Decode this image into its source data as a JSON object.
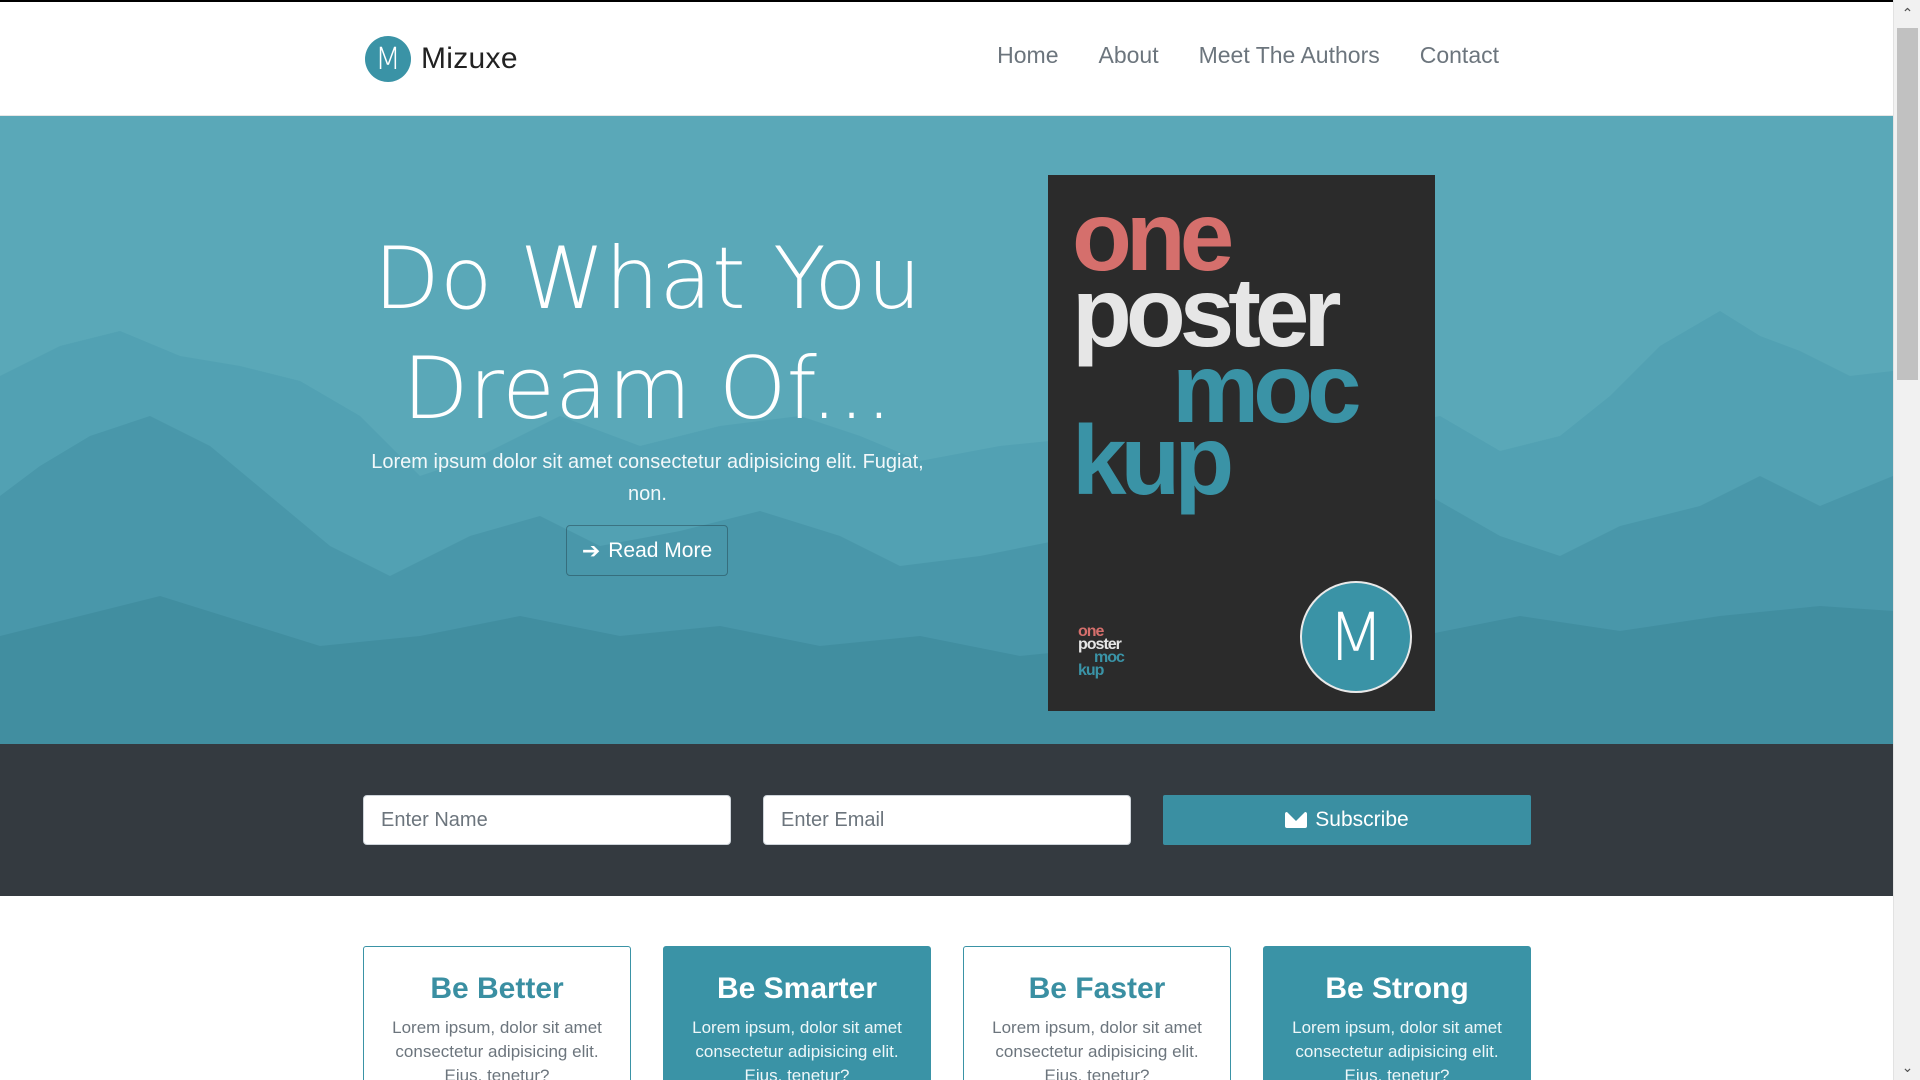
{
  "brand": {
    "logo_letter": "M",
    "name": "Mizuxe"
  },
  "nav": {
    "items": [
      {
        "label": "Home"
      },
      {
        "label": "About"
      },
      {
        "label": "Meet The Authors"
      },
      {
        "label": "Contact"
      }
    ]
  },
  "hero": {
    "title_line1": "Do What You",
    "title_line2": "Dream Of...",
    "text": "Lorem ipsum dolor sit amet consectetur adipisicing elit. Fugiat, non.",
    "button_label": "Read More",
    "button_icon": "arrow-right-icon",
    "background_color": "#5aa8b8"
  },
  "poster": {
    "word1": "one",
    "word2": "poster",
    "word3": "moc",
    "word4": "kup",
    "badge_letter": "M",
    "colors": {
      "one": "#d56f6c",
      "poster": "#e6e6e6",
      "mockup": "#3a93a6",
      "background": "#2b2b2b"
    }
  },
  "subscribe": {
    "name_placeholder": "Enter Name",
    "email_placeholder": "Enter Email",
    "button_label": "Subscribe",
    "button_icon": "envelope-icon",
    "background_color": "#343a40",
    "accent_color": "#3a8fa2"
  },
  "features": [
    {
      "title": "Be Better",
      "text": "Lorem ipsum, dolor sit amet consectetur adipisicing elit. Eius, tenetur?",
      "style": "light"
    },
    {
      "title": "Be Smarter",
      "text": "Lorem ipsum, dolor sit amet consectetur adipisicing elit. Eius, tenetur?",
      "style": "dark"
    },
    {
      "title": "Be Faster",
      "text": "Lorem ipsum, dolor sit amet consectetur adipisicing elit. Eius, tenetur?",
      "style": "light"
    },
    {
      "title": "Be Strong",
      "text": "Lorem ipsum, dolor sit amet consectetur adipisicing elit. Eius, tenetur?",
      "style": "dark"
    }
  ],
  "scrollbar": {
    "up_icon": "chevron-up-icon",
    "down_icon": "chevron-down-icon"
  }
}
